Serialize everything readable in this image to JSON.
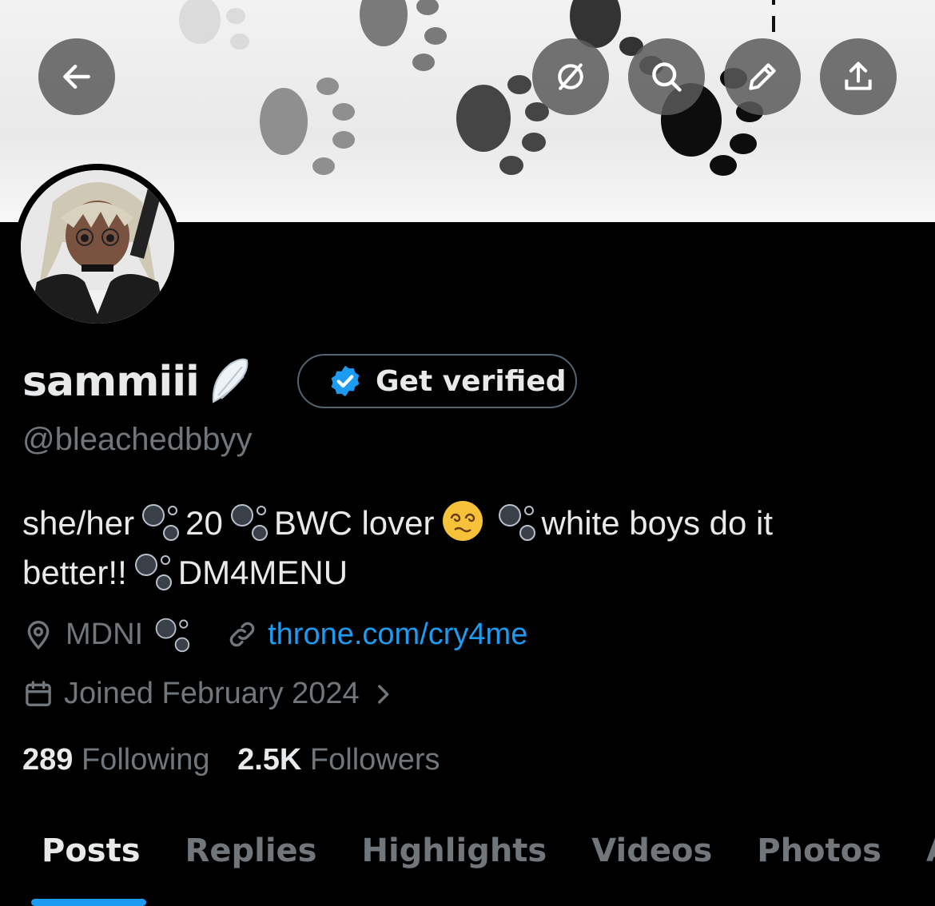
{
  "profile": {
    "display_name": "sammiii",
    "name_emoji": "wing-emoji",
    "verify_label": "Get verified",
    "handle": "@bleachedbbyy",
    "bio": {
      "part1": "she/her",
      "part2": "20",
      "part3": "BWC lover",
      "part4": "white boys do it",
      "part5": "better!!",
      "part6": "DM4MENU"
    },
    "location": "MDNI",
    "website": "throne.com/cry4me",
    "joined": "Joined February 2024"
  },
  "stats": {
    "following_count": "289",
    "following_label": "Following",
    "followers_count": "2.5K",
    "followers_label": "Followers"
  },
  "tabs": [
    {
      "label": "Posts",
      "active": true
    },
    {
      "label": "Replies",
      "active": false
    },
    {
      "label": "Highlights",
      "active": false
    },
    {
      "label": "Videos",
      "active": false
    },
    {
      "label": "Photos",
      "active": false
    },
    {
      "label": "Art",
      "active": false
    }
  ],
  "icons": {
    "back": "arrow-left-icon",
    "grok": "grok-icon",
    "search": "search-icon",
    "edit": "pencil-icon",
    "share": "share-icon"
  },
  "colors": {
    "accent": "#1d9bf0",
    "muted": "#71767b",
    "text": "#e7e9ea",
    "background": "#000000"
  }
}
